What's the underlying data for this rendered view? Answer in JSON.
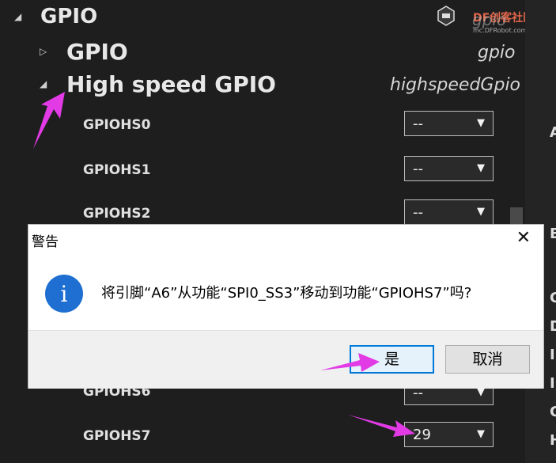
{
  "tree": {
    "root": {
      "label": "GPIO",
      "toggle": "◢"
    },
    "gpio": {
      "label": "GPIO",
      "tag": "gpio",
      "toggle": "▷"
    },
    "hs": {
      "label": "High speed GPIO",
      "tag": "highspeedGpio",
      "toggle": "◢"
    }
  },
  "pins": [
    {
      "label": "GPIOHS0",
      "value": "--"
    },
    {
      "label": "GPIOHS1",
      "value": "--"
    },
    {
      "label": "GPIOHS2",
      "value": "--"
    },
    {
      "label": "GPIOHS6",
      "value": "--"
    },
    {
      "label": "GPIOHS7",
      "value": "29"
    }
  ],
  "select_arrow": "▼",
  "watermark": {
    "brand": "DF创客社区",
    "sub": "mc.DFRobot.com.cn",
    "overlay": "gpio"
  },
  "right_letters": [
    "A",
    "E",
    "C",
    "D",
    "I",
    "I",
    "C",
    "H"
  ],
  "dialog": {
    "title": "警告",
    "close": "✕",
    "icon": "i",
    "message": "将引脚“A6”从功能“SPI0_SS3”移动到功能“GPIOHS7”吗?",
    "yes": "是",
    "no": "取消"
  },
  "colors": {
    "accent_arrow": "#e23be6",
    "info_blue": "#1e6fd1",
    "default_button": "#0078d7"
  }
}
